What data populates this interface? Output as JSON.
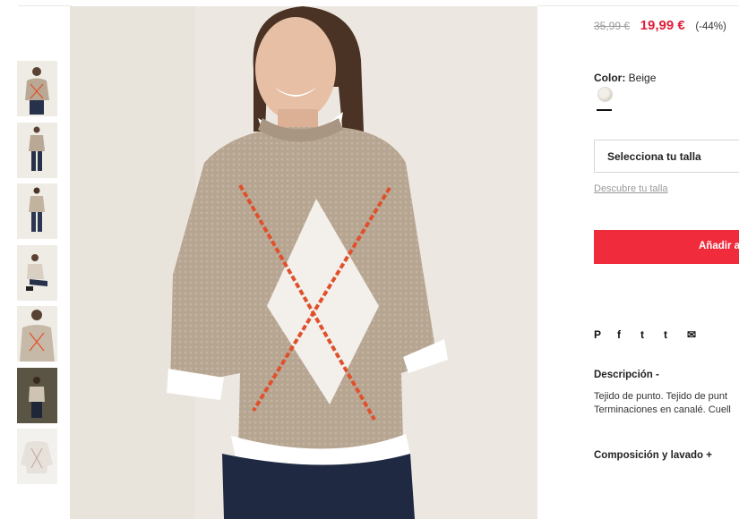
{
  "pricing": {
    "original_price": "35,99 €",
    "sale_price": "19,99 €",
    "discount": "(-44%)"
  },
  "color": {
    "label": "Color:",
    "value": "Beige"
  },
  "size": {
    "select_placeholder": "Selecciona tu talla",
    "size_guide_link": "Descubre tu talla"
  },
  "cart": {
    "add_label": "Añadir a"
  },
  "social_icons": [
    "pinterest-icon",
    "facebook-icon",
    "twitter-icon",
    "tumblr-icon",
    "email-icon"
  ],
  "social_glyphs": [
    "P",
    "f",
    "t",
    "t",
    "✉"
  ],
  "description": {
    "title": "Descripción -",
    "line1": "Tejido de punto. Tejido de punt",
    "line2": "Terminaciones en canalé. Cuell"
  },
  "composition": {
    "title": "Composición y lavado +"
  },
  "colors": {
    "accent_red": "#ef2b3c",
    "price_red": "#e11d3a",
    "sweater": "#b9a894",
    "argyle_orange": "#e0502b"
  }
}
